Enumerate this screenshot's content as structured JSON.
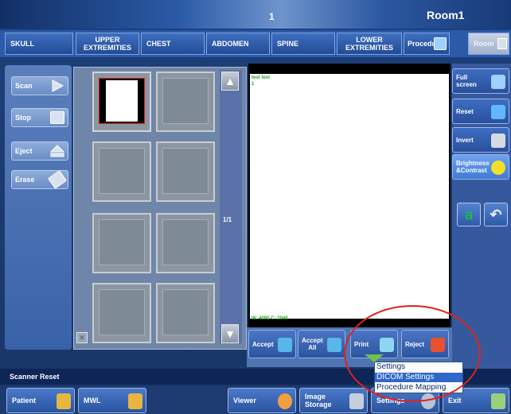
{
  "title": {
    "number": "1",
    "room": "Room1"
  },
  "categories": [
    {
      "label": "SKULL"
    },
    {
      "label": "UPPER\nEXTREMITIES"
    },
    {
      "label": "CHEST"
    },
    {
      "label": "ABDOMEN"
    },
    {
      "label": "SPINE"
    },
    {
      "label": "LOWER\nEXTREMITIES"
    },
    {
      "label": "Procedures"
    },
    {
      "label": "Room"
    }
  ],
  "left_panel": {
    "scan": "Scan",
    "stop": "Stop",
    "eject": "Eject",
    "erase": "Erase"
  },
  "thumbnails": {
    "page": "1/1"
  },
  "viewer": {
    "line1": "test test",
    "line2": "1",
    "wl": "W: 4095 C: 2048"
  },
  "actions": {
    "accept": "Accept",
    "accept_all": "Accept\nAll",
    "print": "Print",
    "reject": "Reject"
  },
  "right_panel": {
    "full_screen": "Full\nscreen",
    "reset": "Reset",
    "invert": "Invert",
    "brightness": "Brightness\n&Contrast"
  },
  "status": "Scanner Reset",
  "bottom": {
    "patient": "Patient",
    "mwl": "MWL",
    "viewer": "Viewer",
    "image_storage": "Image\nStorage",
    "settings": "Settings",
    "exit": "Exit"
  },
  "settings_menu": [
    "Settings",
    "DICOM Settings",
    "Procedure Mapping"
  ],
  "colors": {
    "accent": "#2f68c9",
    "highlight_circle": "#e1221c"
  }
}
